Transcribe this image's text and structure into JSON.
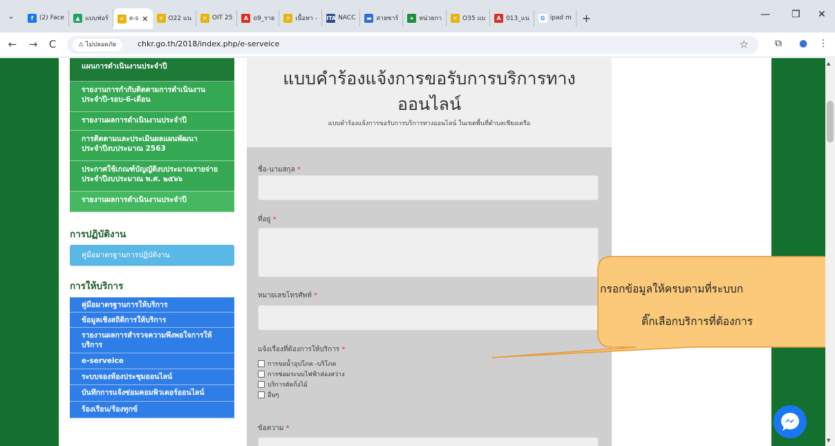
{
  "browser": {
    "tabs": [
      {
        "label": "(2) Face",
        "fav_color": "#1877f2",
        "fav_glyph": "f"
      },
      {
        "label": "แบบฟอร์",
        "fav_color": "#1fa463",
        "fav_glyph": "▲"
      },
      {
        "label": "e-s",
        "fav_color": "#e8b30c",
        "fav_glyph": "✕",
        "active": true
      },
      {
        "label": "O22 แน",
        "fav_color": "#e8b30c",
        "fav_glyph": "✕"
      },
      {
        "label": "OIT 25",
        "fav_color": "#e8b30c",
        "fav_glyph": "✕"
      },
      {
        "label": "o9_ราย",
        "fav_color": "#d93025",
        "fav_glyph": "A"
      },
      {
        "label": "เนื้อหา -",
        "fav_color": "#e8b30c",
        "fav_glyph": "✕"
      },
      {
        "label": "NACC",
        "fav_color": "#2c4a8c",
        "fav_glyph": "ITA"
      },
      {
        "label": "สายซาร์",
        "fav_color": "#2f6fd6",
        "fav_glyph": "▬"
      },
      {
        "label": "หน่วยกา",
        "fav_color": "#1e8e3e",
        "fav_glyph": "+"
      },
      {
        "label": "O35 แบ",
        "fav_color": "#e8b30c",
        "fav_glyph": "✕"
      },
      {
        "label": "013_แน",
        "fav_color": "#d93025",
        "fav_glyph": "A"
      },
      {
        "label": "ipad m",
        "fav_color": "#ffffff",
        "fav_glyph": "G"
      }
    ],
    "tab_close_glyph": "✕",
    "new_tab_glyph": "+",
    "tab_menu_glyph": "⌄",
    "minimize_glyph": "—",
    "restore_glyph": "❐",
    "close_glyph": "✕",
    "back_glyph": "←",
    "forward_glyph": "→",
    "reload_glyph": "C",
    "insecure_label": "⚠ ไม่ปลอดภัย",
    "url": "chkr.go.th/2018/index.php/e-serveice",
    "star_glyph": "☆",
    "ext_glyph": "⧉",
    "profile_glyph": "●",
    "more_glyph": "⋮"
  },
  "sidebar": {
    "plan_items": [
      {
        "label": "แผนการดำเนินงานประจำปี",
        "style": "dark"
      },
      {
        "label": "รายงานการกำกับติดตามการดำเนินงาน",
        "label2": "ประจำปี-รอบ-6-เดือน",
        "style": "mid"
      },
      {
        "label": "รายงานผลการดำเนินงานประจำปี",
        "style": "mid"
      },
      {
        "label": "การติดตามและประเมินผลแผนพัฒนา",
        "label2": "ประจำปีงบประมาณ 2563",
        "style": "mid"
      },
      {
        "label": "ประกาศใช้เกณฑ์บัญญัติงบประมาณรายจ่าย",
        "label2": "ประจำปีงบประมาณ พ.ศ. ๒๕๖๖",
        "style": "mid"
      },
      {
        "label": "รายงานผลการดำเนินงานประจำปี",
        "style": "light"
      }
    ],
    "ops_heading": "การปฏิบัติงาน",
    "ops_item": "คู่มือมาตรฐานการปฏิบัติงาน",
    "service_heading": "การให้บริการ",
    "service_items": [
      {
        "label": "คู่มือมาตรฐานการให้บริการ"
      },
      {
        "label": "ข้อมูลเชิงสถิติการให้บริการ"
      },
      {
        "label": "รายงานผลการสำรวจความพึงพอใจการให้",
        "label2": "บริการ"
      },
      {
        "label": "e-serveice"
      },
      {
        "label": "ระบบจองห้องประชุมออนไลน์"
      },
      {
        "label": "บันทึกการแจ้งซ่อมคอมพิวเตอร์ออนไลน์"
      },
      {
        "label": "ร้องเรียน/ร้องทุกข์"
      }
    ]
  },
  "form": {
    "title_line1": "แบบคำร้องแจ้งการขอรับการบริการทาง",
    "title_line2": "ออนไลน์",
    "subtitle": "แบบคำร้องแจ้งการขอรับการบริการทางออนไลน์ ในเขตพื้นที่ตำบลเชียงเครือ",
    "name_label": "ชื่อ-นามสกุล",
    "address_label": "ที่อยู่",
    "phone_label": "หมายเลขโทรศัพท์",
    "service_label": "แจ้งเรื่องที่ต้องการให้บริการ",
    "service_options": [
      "การขอน้ำอุปโภค -บริโภค",
      "การซ่อมระบบไฟฟ้าส่องสว่าง",
      "บริการตัดกิ่งไม้",
      "อื่นๆ"
    ],
    "message_label": "ข้อความ",
    "required_mark": "*"
  },
  "callout": {
    "line1": "กรอกข้อมูลให้ครบตามที่ระบบก",
    "line2": "ติ๊กเลือกบริการที่ต้องการ",
    "fill_color": "#fbc97a",
    "stroke_color": "#e8973a"
  },
  "colors": {
    "site_green": "#14702f",
    "menu_blue": "#2f7ee8",
    "menu_lightblue": "#5ab8e6",
    "messenger_blue": "#1877f2"
  }
}
